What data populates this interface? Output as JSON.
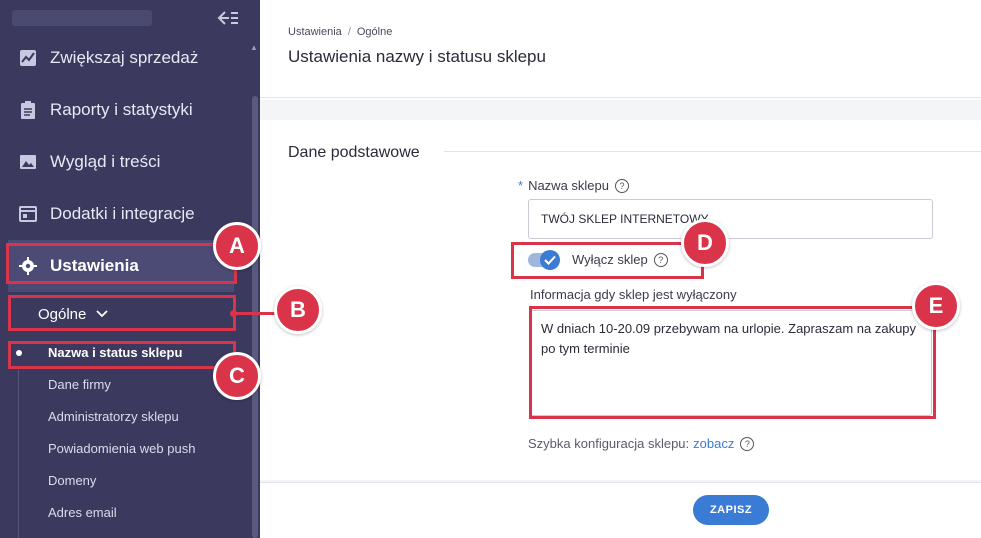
{
  "sidebar": {
    "nav": [
      {
        "label": "Zwiększaj sprzedaż",
        "icon": "chart-icon"
      },
      {
        "label": "Raporty i statystyki",
        "icon": "clipboard-icon"
      },
      {
        "label": "Wygląd i treści",
        "icon": "image-icon"
      },
      {
        "label": "Dodatki i integracje",
        "icon": "calendar-icon"
      },
      {
        "label": "Ustawienia",
        "icon": "gear-icon"
      }
    ],
    "submenu_label": "Ogólne",
    "sub_items": [
      "Nazwa i status sklepu",
      "Dane firmy",
      "Administratorzy sklepu",
      "Powiadomienia web push",
      "Domeny",
      "Adres email"
    ]
  },
  "header": {
    "breadcrumb": [
      "Ustawienia",
      "Ogólne"
    ],
    "title": "Ustawienia nazwy i statusu sklepu"
  },
  "form": {
    "section_title": "Dane podstawowe",
    "name_required_mark": "*",
    "name_label": "Nazwa sklepu",
    "name_value": "TWÓJ SKLEP INTERNETOWY",
    "toggle_label": "Wyłącz sklep",
    "toggle_on": true,
    "message_label": "Informacja gdy sklep jest wyłączony",
    "message_value": "W dniach 10-20.09 przebywam na urlopie. Zapraszam na zakupy po tym terminie",
    "quick_config_text": "Szybka konfiguracja sklepu:",
    "quick_config_link": "zobacz"
  },
  "footer": {
    "save_label": "ZAPISZ"
  },
  "annotations": {
    "labels": [
      "A",
      "B",
      "C",
      "D",
      "E"
    ],
    "color": "#d9344a"
  },
  "colors": {
    "sidebar_bg": "#3b3a5e",
    "accent": "#3a7bd5"
  }
}
